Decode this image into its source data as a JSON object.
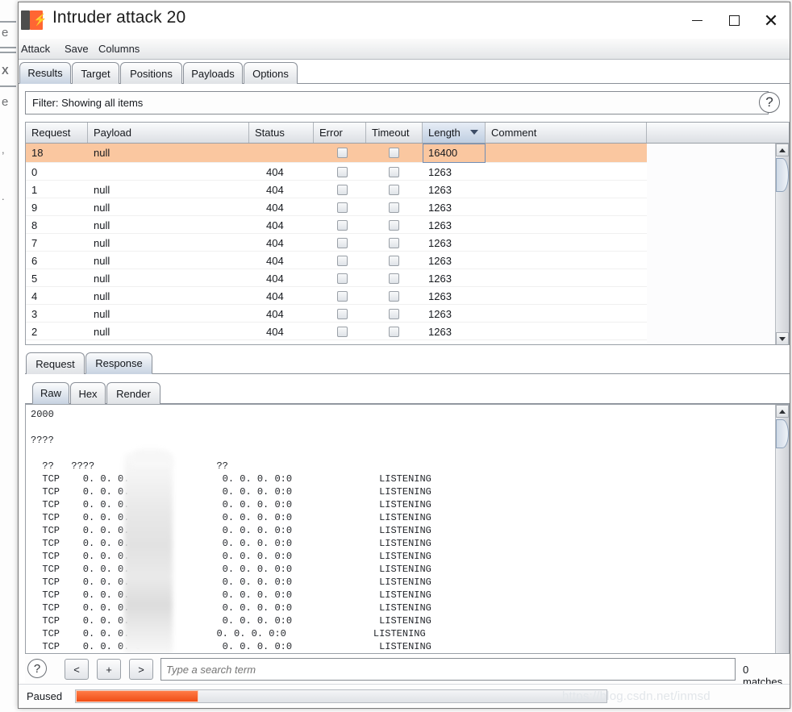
{
  "window": {
    "title": "Intruder attack 20",
    "icon": "burp-suite-icon",
    "controls": {
      "minimize": "–",
      "maximize": "□",
      "close": "×"
    }
  },
  "menubar": {
    "items": [
      "Attack",
      "Save",
      "Columns"
    ]
  },
  "main_tabs": {
    "items": [
      "Results",
      "Target",
      "Positions",
      "Payloads",
      "Options"
    ],
    "selected": "Results"
  },
  "filter": {
    "label": "Filter: Showing all items",
    "help_icon": "?"
  },
  "results_table": {
    "columns": [
      "Request",
      "Payload",
      "Status",
      "Error",
      "Timeout",
      "Length",
      "Comment"
    ],
    "sorted_column": "Length",
    "sort_direction": "descending",
    "rows": [
      {
        "request": "18",
        "payload": "null",
        "status": "",
        "error": false,
        "timeout": false,
        "length": "16400",
        "comment": "",
        "selected": true
      },
      {
        "request": "0",
        "payload": "",
        "status": "404",
        "error": false,
        "timeout": false,
        "length": "1263",
        "comment": "",
        "selected": false
      },
      {
        "request": "1",
        "payload": "null",
        "status": "404",
        "error": false,
        "timeout": false,
        "length": "1263",
        "comment": "",
        "selected": false
      },
      {
        "request": "9",
        "payload": "null",
        "status": "404",
        "error": false,
        "timeout": false,
        "length": "1263",
        "comment": "",
        "selected": false
      },
      {
        "request": "8",
        "payload": "null",
        "status": "404",
        "error": false,
        "timeout": false,
        "length": "1263",
        "comment": "",
        "selected": false
      },
      {
        "request": "7",
        "payload": "null",
        "status": "404",
        "error": false,
        "timeout": false,
        "length": "1263",
        "comment": "",
        "selected": false
      },
      {
        "request": "6",
        "payload": "null",
        "status": "404",
        "error": false,
        "timeout": false,
        "length": "1263",
        "comment": "",
        "selected": false
      },
      {
        "request": "5",
        "payload": "null",
        "status": "404",
        "error": false,
        "timeout": false,
        "length": "1263",
        "comment": "",
        "selected": false
      },
      {
        "request": "4",
        "payload": "null",
        "status": "404",
        "error": false,
        "timeout": false,
        "length": "1263",
        "comment": "",
        "selected": false
      },
      {
        "request": "3",
        "payload": "null",
        "status": "404",
        "error": false,
        "timeout": false,
        "length": "1263",
        "comment": "",
        "selected": false
      },
      {
        "request": "2",
        "payload": "null",
        "status": "404",
        "error": false,
        "timeout": false,
        "length": "1263",
        "comment": "",
        "selected": false
      }
    ]
  },
  "message_tabs": {
    "items": [
      "Request",
      "Response"
    ],
    "selected": "Response"
  },
  "view_tabs": {
    "items": [
      "Raw",
      "Hex",
      "Render"
    ],
    "selected": "Raw"
  },
  "response_body": {
    "lines": [
      "2000",
      "",
      "????",
      "",
      "  ??   ????                     ??",
      "  TCP    0. 0. 0. 0              0. 0. 0. 0:0               LISTENING",
      "  TCP    0. 0. 0. 0              0. 0. 0. 0:0               LISTENING",
      "  TCP    0. 0. 0. 0.             0. 0. 0. 0:0               LISTENING",
      "  TCP    0. 0. 0. 0:             0. 0. 0. 0:0               LISTENING",
      "  TCP    0. 0. 0. 0:             0. 0. 0. 0:0               LISTENING",
      "  TCP    0. 0. 0. 0:             0. 0. 0. 0:0               LISTENING",
      "  TCP    0. 0. 0. 0:             0. 0. 0. 0:0               LISTENING",
      "  TCP    0. 0. 0. 0:             0. 0. 0. 0:0               LISTENING",
      "  TCP    0. 0. 0. 0:             0. 0. 0. 0:0               LISTENING",
      "  TCP    0. 0. 0. 0:             0. 0. 0. 0:0               LISTENING",
      "  TCP    0. 0. 0. 0:             0. 0. 0. 0:0               LISTENING",
      "  TCP    0. 0. 0. 0:             0. 0. 0. 0:0               LISTENING",
      "  TCP    0. 0. 0. 0·            0. 0. 0. 0:0               LISTENING",
      "  TCP    0. 0. 0. 0              0. 0. 0. 0:0               LISTENING",
      "  TCP    0. 0. 0. 0.             0. 0. 0. 0:0               LISTENING"
    ],
    "redacted_note": "?"
  },
  "search": {
    "help_icon": "?",
    "prev_label": "<",
    "add_label": "+",
    "next_label": ">",
    "placeholder": "Type a search term",
    "value": "",
    "matches": "0 matches"
  },
  "status": {
    "label": "Paused",
    "progress_percent": 23
  },
  "watermark": "https://blog.csdn.net/inmsd",
  "background_window": {
    "fragments": [
      "e",
      "X",
      "e",
      ",",
      "."
    ]
  },
  "colors": {
    "selection": "#fac7a0",
    "accent": "#ff6633",
    "progress": "#f04e16",
    "tab_selected": "#c9d4e2",
    "border": "#9aa0a7"
  }
}
